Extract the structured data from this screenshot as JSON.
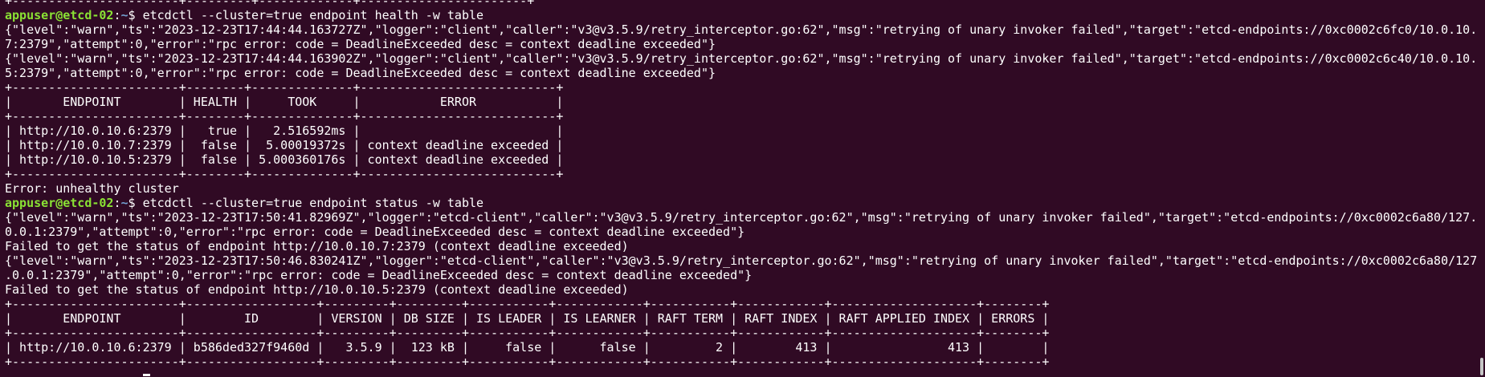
{
  "terminal": {
    "prompt": {
      "user_host": "appuser@etcd-02",
      "separator": ":",
      "path": "~",
      "symbol": "$ "
    },
    "lines": [
      {
        "type": "output",
        "text": "+-----------------------+---------+-------------+-----------------------+"
      },
      {
        "type": "prompt",
        "text": "etcdctl --cluster=true endpoint health -w table"
      },
      {
        "type": "output",
        "text": "{\"level\":\"warn\",\"ts\":\"2023-12-23T17:44:44.163727Z\",\"logger\":\"client\",\"caller\":\"v3@v3.5.9/retry_interceptor.go:62\",\"msg\":\"retrying of unary invoker failed\",\"target\":\"etcd-endpoints://0xc0002c6fc0/10.0.10."
      },
      {
        "type": "output",
        "text": "7:2379\",\"attempt\":0,\"error\":\"rpc error: code = DeadlineExceeded desc = context deadline exceeded\"}"
      },
      {
        "type": "output",
        "text": "{\"level\":\"warn\",\"ts\":\"2023-12-23T17:44:44.163902Z\",\"logger\":\"client\",\"caller\":\"v3@v3.5.9/retry_interceptor.go:62\",\"msg\":\"retrying of unary invoker failed\",\"target\":\"etcd-endpoints://0xc0002c6c40/10.0.10."
      },
      {
        "type": "output",
        "text": "5:2379\",\"attempt\":0,\"error\":\"rpc error: code = DeadlineExceeded desc = context deadline exceeded\"}"
      },
      {
        "type": "output",
        "text": "+-----------------------+--------+--------------+---------------------------+"
      },
      {
        "type": "output",
        "text": "|       ENDPOINT        | HEALTH |     TOOK     |           ERROR           |"
      },
      {
        "type": "output",
        "text": "+-----------------------+--------+--------------+---------------------------+"
      },
      {
        "type": "output",
        "text": "| http://10.0.10.6:2379 |   true |   2.516592ms |                           |"
      },
      {
        "type": "output",
        "text": "| http://10.0.10.7:2379 |  false |  5.00019372s | context deadline exceeded |"
      },
      {
        "type": "output",
        "text": "| http://10.0.10.5:2379 |  false | 5.000360176s | context deadline exceeded |"
      },
      {
        "type": "output",
        "text": "+-----------------------+--------+--------------+---------------------------+"
      },
      {
        "type": "output",
        "text": "Error: unhealthy cluster"
      },
      {
        "type": "prompt",
        "text": "etcdctl --cluster=true endpoint status -w table"
      },
      {
        "type": "output",
        "text": "{\"level\":\"warn\",\"ts\":\"2023-12-23T17:50:41.82969Z\",\"logger\":\"etcd-client\",\"caller\":\"v3@v3.5.9/retry_interceptor.go:62\",\"msg\":\"retrying of unary invoker failed\",\"target\":\"etcd-endpoints://0xc0002c6a80/127."
      },
      {
        "type": "output",
        "text": "0.0.1:2379\",\"attempt\":0,\"error\":\"rpc error: code = DeadlineExceeded desc = context deadline exceeded\"}"
      },
      {
        "type": "output",
        "text": "Failed to get the status of endpoint http://10.0.10.7:2379 (context deadline exceeded)"
      },
      {
        "type": "output",
        "text": "{\"level\":\"warn\",\"ts\":\"2023-12-23T17:50:46.830241Z\",\"logger\":\"etcd-client\",\"caller\":\"v3@v3.5.9/retry_interceptor.go:62\",\"msg\":\"retrying of unary invoker failed\",\"target\":\"etcd-endpoints://0xc0002c6a80/127"
      },
      {
        "type": "output",
        "text": ".0.0.1:2379\",\"attempt\":0,\"error\":\"rpc error: code = DeadlineExceeded desc = context deadline exceeded\"}"
      },
      {
        "type": "output",
        "text": "Failed to get the status of endpoint http://10.0.10.5:2379 (context deadline exceeded)"
      },
      {
        "type": "output",
        "text": "+-----------------------+------------------+---------+---------+-----------+------------+-----------+------------+--------------------+--------+"
      },
      {
        "type": "output",
        "text": "|       ENDPOINT        |        ID        | VERSION | DB SIZE | IS LEADER | IS LEARNER | RAFT TERM | RAFT INDEX | RAFT APPLIED INDEX | ERRORS |"
      },
      {
        "type": "output",
        "text": "+-----------------------+------------------+---------+---------+-----------+------------+-----------+------------+--------------------+--------+"
      },
      {
        "type": "output",
        "text": "| http://10.0.10.6:2379 | b586ded327f9460d |   3.5.9 |  123 kB |     false |      false |         2 |        413 |                413 |        |"
      },
      {
        "type": "output",
        "text": "+-----------------------+------------------+---------+---------+-----------+------------+-----------+------------+--------------------+--------+"
      }
    ]
  },
  "colors": {
    "background": "#300a24",
    "prompt_user": "#8ae234",
    "prompt_path": "#729fcf",
    "text": "#ffffff"
  }
}
